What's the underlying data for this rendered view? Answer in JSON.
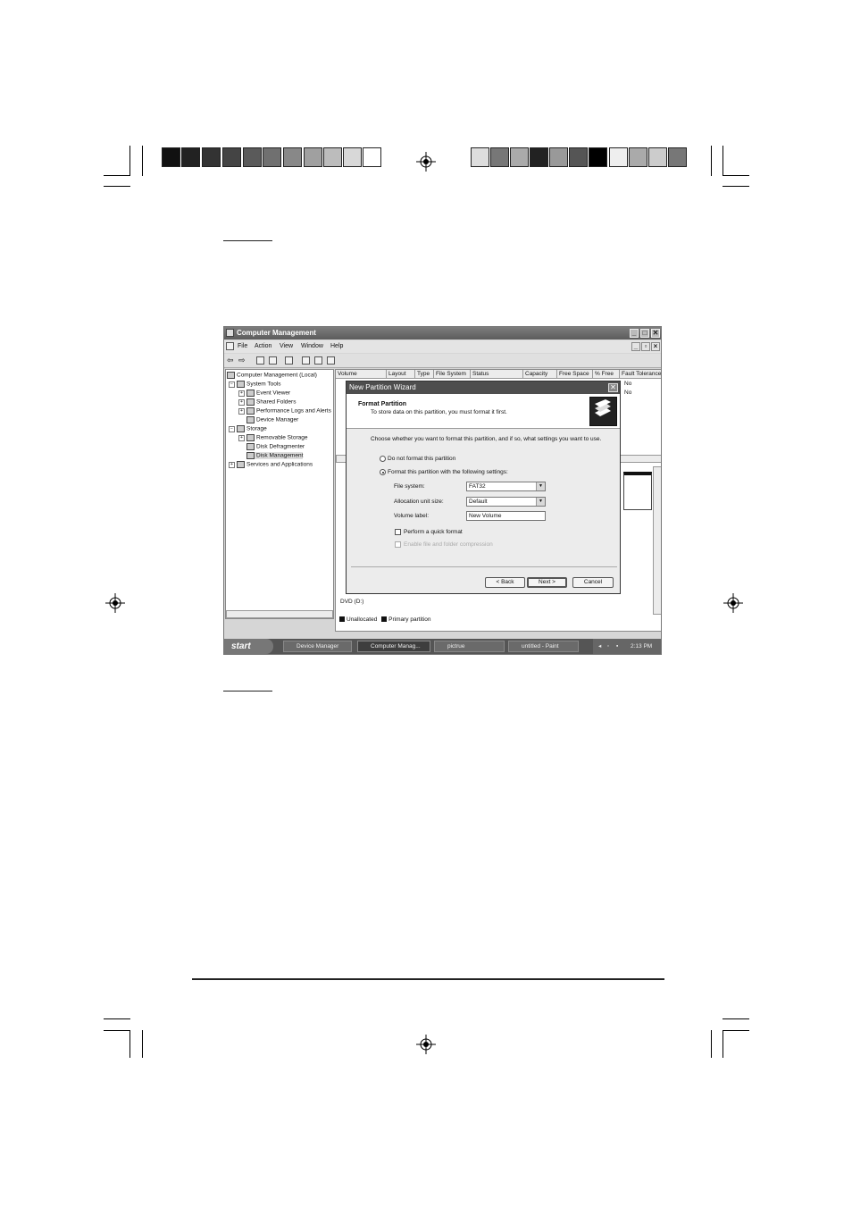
{
  "window": {
    "title": "Computer Management",
    "controls": {
      "minimize": "_",
      "maximize": "□",
      "close": "✕"
    }
  },
  "menu": [
    "File",
    "Action",
    "View",
    "Window",
    "Help"
  ],
  "tree": {
    "root": "Computer Management (Local)",
    "items": [
      "System Tools",
      "Event Viewer",
      "Shared Folders",
      "Performance Logs and Alerts",
      "Device Manager",
      "Storage",
      "Removable Storage",
      "Disk Defragmenter",
      "Disk Management",
      "Services and Applications"
    ]
  },
  "columns": [
    "Volume",
    "Layout",
    "Type",
    "File System",
    "Status",
    "Capacity",
    "Free Space",
    "% Free",
    "Fault Tolerance"
  ],
  "fault_values": [
    "No",
    "No"
  ],
  "disk_partial": {
    "dvd_label": "DVD (D:)",
    "legend": [
      "Unallocated",
      "Primary partition"
    ]
  },
  "dialog": {
    "title": "New Partition Wizard",
    "heading": "Format Partition",
    "subheading": "To store data on this partition, you must format it first.",
    "instruction": "Choose whether you want to format this partition, and if so, what settings you want to use.",
    "radio_no_format": "Do not format this partition",
    "radio_format": "Format this partition with the following settings:",
    "file_system_label": "File system:",
    "file_system_value": "FAT32",
    "alloc_label": "Allocation unit size:",
    "alloc_value": "Default",
    "volume_label": "Volume label:",
    "volume_value": "New Volume",
    "quick_format": "Perform a quick format",
    "compression": "Enable file and folder compression",
    "back": "< Back",
    "next": "Next >",
    "cancel": "Cancel"
  },
  "taskbar": {
    "start": "start",
    "tasks": [
      "Device Manager",
      "Computer Manag...",
      "pictrue",
      "untitled - Paint"
    ],
    "clock": "2:13 PM"
  }
}
